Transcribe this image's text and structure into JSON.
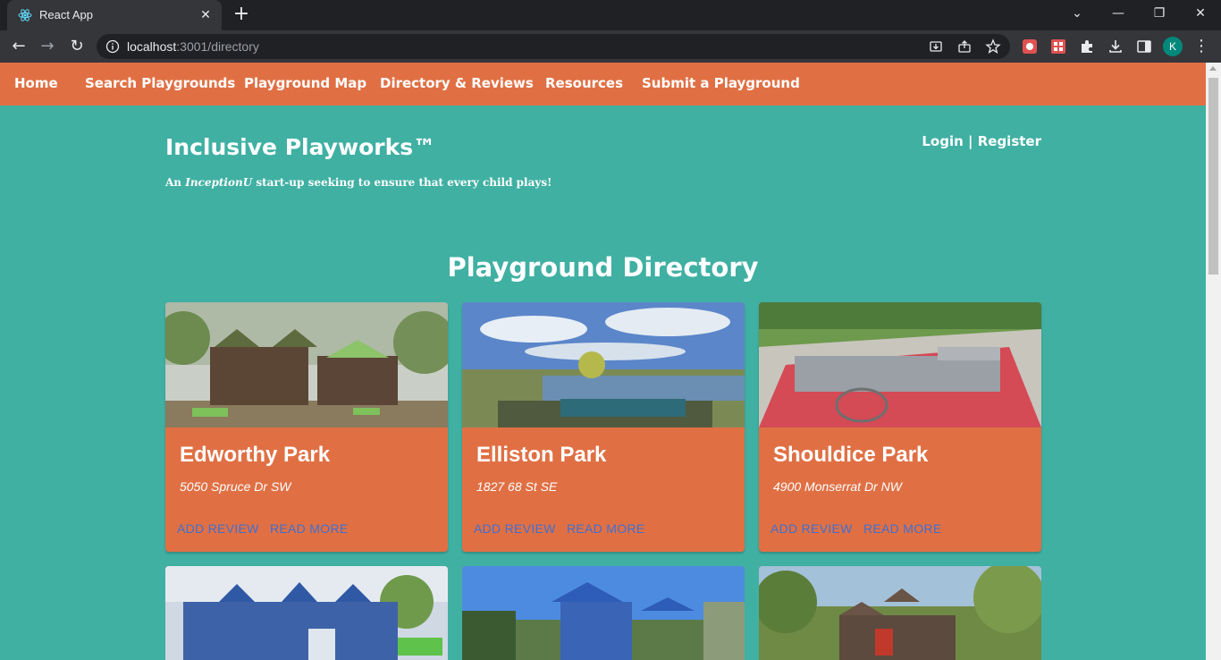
{
  "browser": {
    "tab_title": "React App",
    "url_host": "localhost",
    "url_rest": ":3001/directory",
    "profile_initial": "K"
  },
  "nav": {
    "items": [
      {
        "label": "Home"
      },
      {
        "label": "Search Playgrounds"
      },
      {
        "label": "Playground Map"
      },
      {
        "label": "Directory & Reviews"
      },
      {
        "label": "Resources"
      },
      {
        "label": "Submit a Playground"
      }
    ]
  },
  "header": {
    "brand": "Inclusive Playworks™",
    "tagline_prefix": "An ",
    "tagline_emph": "InceptionU",
    "tagline_suffix": " start-up seeking to ensure that every child plays!",
    "login": "Login",
    "separator": " | ",
    "register": "Register"
  },
  "directory": {
    "title": "Playground Directory",
    "add_review_label": "ADD REVIEW",
    "read_more_label": "READ MORE",
    "parks": [
      {
        "name": "Edworthy Park",
        "address": "5050 Spruce Dr SW"
      },
      {
        "name": "Elliston Park",
        "address": "1827 68 St SE"
      },
      {
        "name": "Shouldice Park",
        "address": "4900 Monserrat Dr NW"
      }
    ]
  },
  "colors": {
    "page_bg": "#40b0a3",
    "nav_bg": "#e07044",
    "card_bg": "#e07044",
    "link": "#3f6fd1"
  }
}
